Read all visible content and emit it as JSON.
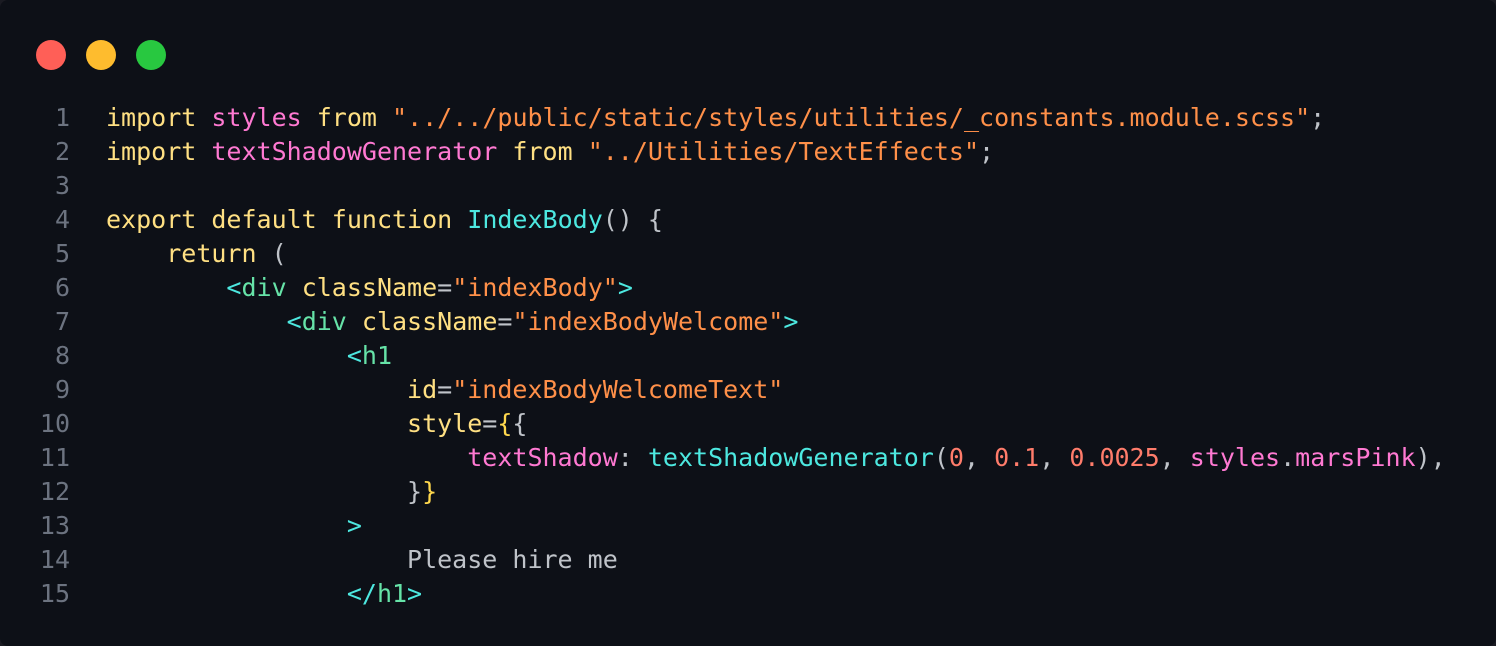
{
  "window": {
    "controls": {
      "close_color": "#ff5f57",
      "minimize_color": "#febc2e",
      "maximize_color": "#28c840"
    }
  },
  "colors": {
    "keyword": "#ffe083",
    "import_name": "#ff79d2",
    "string": "#ff9049",
    "plain": "#bfc3c9",
    "function": "#4de8e0",
    "tag": "#4de8e0",
    "tag_name": "#66e3a8",
    "attr": "#ffe083",
    "number": "#ff7c6b",
    "property": "#ff79d2",
    "text": "#bfc3c9",
    "brace": "#ffd84d"
  },
  "code": {
    "lines": [
      {
        "num": "1",
        "tokens": [
          {
            "t": "import",
            "c": "keyword"
          },
          {
            "t": " ",
            "c": "plain"
          },
          {
            "t": "styles",
            "c": "import_name"
          },
          {
            "t": " ",
            "c": "plain"
          },
          {
            "t": "from",
            "c": "keyword"
          },
          {
            "t": " ",
            "c": "plain"
          },
          {
            "t": "\"../../public/static/styles/utilities/_constants.module.scss\"",
            "c": "string"
          },
          {
            "t": ";",
            "c": "plain"
          }
        ]
      },
      {
        "num": "2",
        "tokens": [
          {
            "t": "import",
            "c": "keyword"
          },
          {
            "t": " ",
            "c": "plain"
          },
          {
            "t": "textShadowGenerator",
            "c": "import_name"
          },
          {
            "t": " ",
            "c": "plain"
          },
          {
            "t": "from",
            "c": "keyword"
          },
          {
            "t": " ",
            "c": "plain"
          },
          {
            "t": "\"../Utilities/TextEffects\"",
            "c": "string"
          },
          {
            "t": ";",
            "c": "plain"
          }
        ]
      },
      {
        "num": "3",
        "tokens": []
      },
      {
        "num": "4",
        "tokens": [
          {
            "t": "export",
            "c": "keyword"
          },
          {
            "t": " ",
            "c": "plain"
          },
          {
            "t": "default",
            "c": "keyword"
          },
          {
            "t": " ",
            "c": "plain"
          },
          {
            "t": "function",
            "c": "keyword"
          },
          {
            "t": " ",
            "c": "plain"
          },
          {
            "t": "IndexBody",
            "c": "function"
          },
          {
            "t": "() {",
            "c": "plain"
          }
        ]
      },
      {
        "num": "5",
        "tokens": [
          {
            "t": "    ",
            "c": "plain"
          },
          {
            "t": "return",
            "c": "keyword"
          },
          {
            "t": " (",
            "c": "plain"
          }
        ]
      },
      {
        "num": "6",
        "tokens": [
          {
            "t": "        ",
            "c": "plain"
          },
          {
            "t": "<",
            "c": "tag"
          },
          {
            "t": "div",
            "c": "tag_name"
          },
          {
            "t": " ",
            "c": "plain"
          },
          {
            "t": "className",
            "c": "attr"
          },
          {
            "t": "=",
            "c": "plain"
          },
          {
            "t": "\"indexBody\"",
            "c": "string"
          },
          {
            "t": ">",
            "c": "tag"
          }
        ]
      },
      {
        "num": "7",
        "tokens": [
          {
            "t": "            ",
            "c": "plain"
          },
          {
            "t": "<",
            "c": "tag"
          },
          {
            "t": "div",
            "c": "tag_name"
          },
          {
            "t": " ",
            "c": "plain"
          },
          {
            "t": "className",
            "c": "attr"
          },
          {
            "t": "=",
            "c": "plain"
          },
          {
            "t": "\"indexBodyWelcome\"",
            "c": "string"
          },
          {
            "t": ">",
            "c": "tag"
          }
        ]
      },
      {
        "num": "8",
        "tokens": [
          {
            "t": "                ",
            "c": "plain"
          },
          {
            "t": "<",
            "c": "tag"
          },
          {
            "t": "h1",
            "c": "tag_name"
          }
        ]
      },
      {
        "num": "9",
        "tokens": [
          {
            "t": "                    ",
            "c": "plain"
          },
          {
            "t": "id",
            "c": "attr"
          },
          {
            "t": "=",
            "c": "plain"
          },
          {
            "t": "\"indexBodyWelcomeText\"",
            "c": "string"
          }
        ]
      },
      {
        "num": "10",
        "tokens": [
          {
            "t": "                    ",
            "c": "plain"
          },
          {
            "t": "style",
            "c": "attr"
          },
          {
            "t": "=",
            "c": "plain"
          },
          {
            "t": "{",
            "c": "brace"
          },
          {
            "t": "{",
            "c": "plain"
          }
        ]
      },
      {
        "num": "11",
        "tokens": [
          {
            "t": "                        ",
            "c": "plain"
          },
          {
            "t": "textShadow",
            "c": "property"
          },
          {
            "t": ": ",
            "c": "plain"
          },
          {
            "t": "textShadowGenerator",
            "c": "function"
          },
          {
            "t": "(",
            "c": "plain"
          },
          {
            "t": "0",
            "c": "number"
          },
          {
            "t": ", ",
            "c": "plain"
          },
          {
            "t": "0.1",
            "c": "number"
          },
          {
            "t": ", ",
            "c": "plain"
          },
          {
            "t": "0.0025",
            "c": "number"
          },
          {
            "t": ", ",
            "c": "plain"
          },
          {
            "t": "styles",
            "c": "import_name"
          },
          {
            "t": ".",
            "c": "plain"
          },
          {
            "t": "marsPink",
            "c": "import_name"
          },
          {
            "t": "),",
            "c": "plain"
          }
        ]
      },
      {
        "num": "12",
        "tokens": [
          {
            "t": "                    ",
            "c": "plain"
          },
          {
            "t": "}",
            "c": "plain"
          },
          {
            "t": "}",
            "c": "brace"
          }
        ]
      },
      {
        "num": "13",
        "tokens": [
          {
            "t": "                ",
            "c": "plain"
          },
          {
            "t": ">",
            "c": "tag"
          }
        ]
      },
      {
        "num": "14",
        "tokens": [
          {
            "t": "                    ",
            "c": "plain"
          },
          {
            "t": "Please hire me",
            "c": "text"
          }
        ]
      },
      {
        "num": "15",
        "tokens": [
          {
            "t": "                ",
            "c": "plain"
          },
          {
            "t": "</",
            "c": "tag"
          },
          {
            "t": "h1",
            "c": "tag_name"
          },
          {
            "t": ">",
            "c": "tag"
          }
        ]
      }
    ]
  }
}
